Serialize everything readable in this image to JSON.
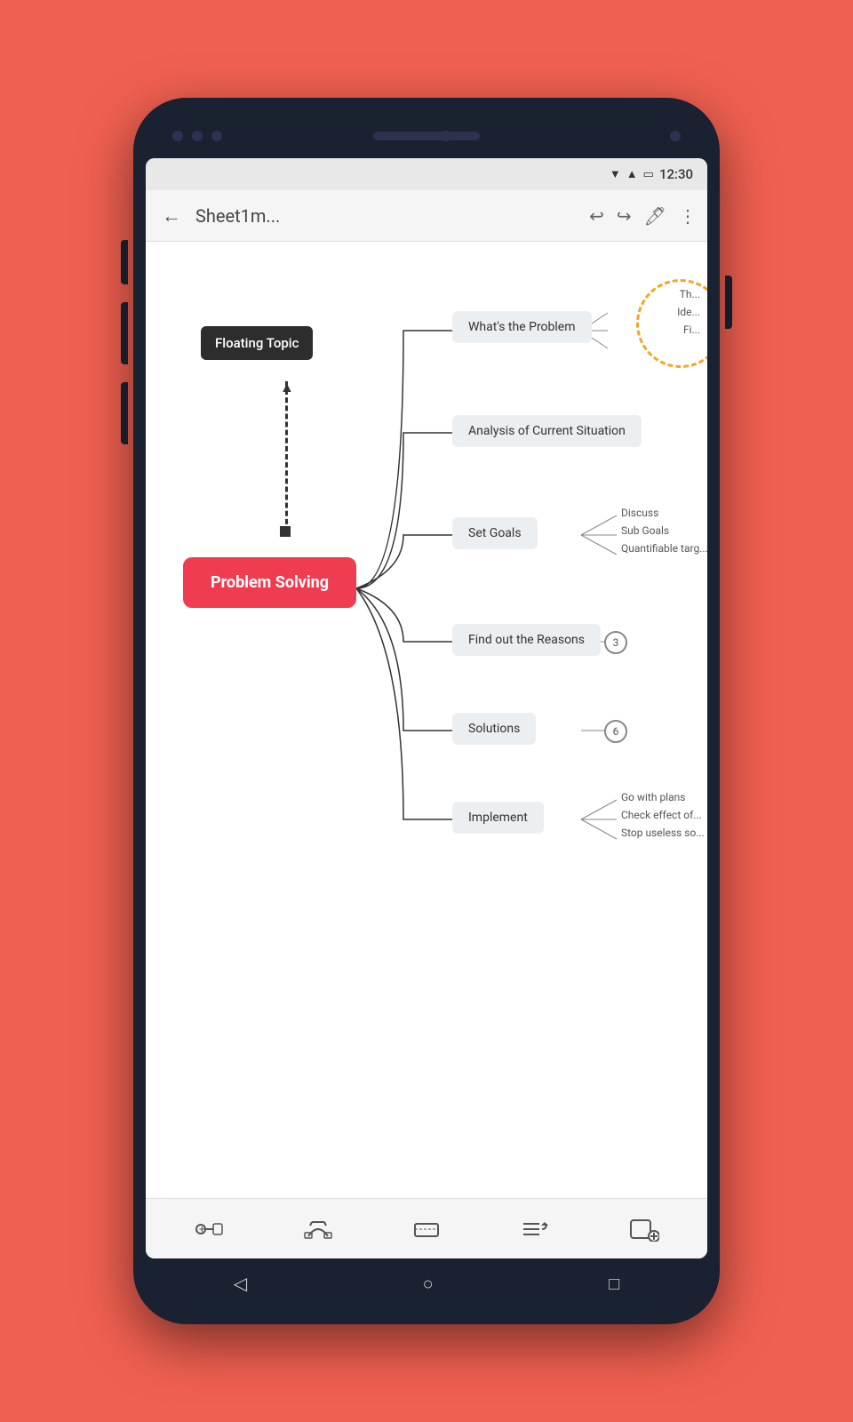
{
  "statusBar": {
    "time": "12:30"
  },
  "appBar": {
    "title": "Sheet1m...",
    "backLabel": "←",
    "undoLabel": "↩",
    "redoLabel": "↪"
  },
  "mindmap": {
    "floatingTopic": "Floating Topic",
    "centralNode": "Problem Solving",
    "nodes": [
      {
        "id": "whats",
        "label": "What's the Problem"
      },
      {
        "id": "analysis",
        "label": "Analysis of Current Situation"
      },
      {
        "id": "setgoals",
        "label": "Set Goals"
      },
      {
        "id": "findout",
        "label": "Find out the Reasons"
      },
      {
        "id": "solutions",
        "label": "Solutions"
      },
      {
        "id": "implement",
        "label": "Implement"
      }
    ],
    "findoutBadge": "3",
    "solutionsBadge": "6",
    "setgoalsSubs": [
      "Discuss",
      "Sub Goals",
      "Quantifiable targ..."
    ],
    "implementSubs": [
      "Go with plans",
      "Check effect of...",
      "Stop useless so..."
    ],
    "whatsSubLabels": [
      "Th...",
      "Ide...",
      "Fi..."
    ]
  },
  "bottomNav": {
    "addTopic": "+",
    "connectIcon": "⌒",
    "insertIcon": "▭",
    "outlineIcon": "≡)",
    "addIcon": "⊕"
  }
}
